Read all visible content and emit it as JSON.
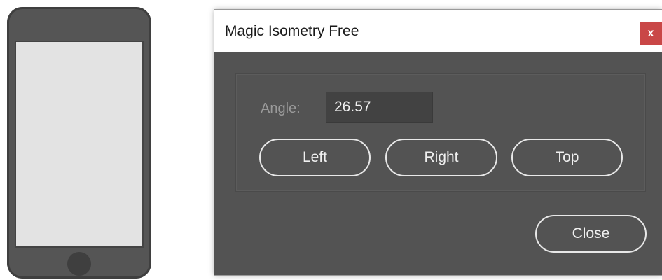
{
  "dialog": {
    "title": "Magic Isometry Free",
    "close_glyph": "x",
    "angle": {
      "label": "Angle:",
      "value": "26.57"
    },
    "buttons": {
      "left": "Left",
      "right": "Right",
      "top": "Top",
      "close": "Close"
    }
  },
  "colors": {
    "dialog_bg": "#535353",
    "titlebar_bg": "#ffffff",
    "close_button_bg": "#c94747",
    "phone_body": "#555555",
    "phone_screen": "#e3e3e3"
  },
  "icons": {
    "phone": "smartphone-illustration"
  }
}
